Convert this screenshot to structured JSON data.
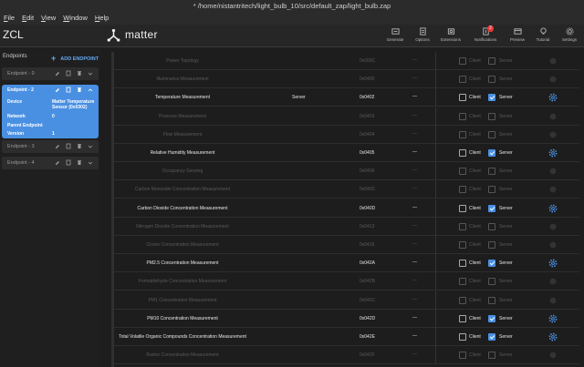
{
  "window": {
    "title": "* /home/nistantritech/light_bulb_10/src/default_zap/light_bulb.zap"
  },
  "menu": [
    {
      "pre": "",
      "u": "F",
      "post": "ile"
    },
    {
      "pre": "",
      "u": "E",
      "post": "dit"
    },
    {
      "pre": "",
      "u": "V",
      "post": "iew"
    },
    {
      "pre": "",
      "u": "W",
      "post": "indow"
    },
    {
      "pre": "",
      "u": "H",
      "post": "elp"
    }
  ],
  "app": {
    "zcl_label": "ZCL",
    "brand": "matter"
  },
  "toolbar": {
    "generate": "Generate",
    "options": "Options",
    "extensions": "Extensions",
    "notifications": "Notifications",
    "notifications_count": "2",
    "preview": "Preview",
    "tutorial": "Tutorial",
    "settings": "Settings"
  },
  "sidebar": {
    "heading": "Endpoints",
    "add_label": "ADD ENDPOINT",
    "endpoint0": "Endpoint - 0",
    "endpoint2": {
      "title": "Endpoint - 2",
      "device_key": "Device",
      "device_val_1": "Matter Temperature",
      "device_val_2": "Sensor (0x0302)",
      "network_key": "Network",
      "network_val": "0",
      "parent_key": "Parent Endpoint",
      "version_key": "Version",
      "version_val": "1"
    },
    "endpoint3": "Endpoint - 3",
    "endpoint4": "Endpoint - 4"
  },
  "clusters": {
    "client_label": "Client",
    "server_label": "Server",
    "rows": [
      {
        "name": "Power Topology",
        "side": "",
        "code": "0x009C",
        "dash": "—",
        "client": false,
        "server": false,
        "enabled": false
      },
      {
        "name": "Illuminance Measurement",
        "side": "",
        "code": "0x0400",
        "dash": "—",
        "client": false,
        "server": false,
        "enabled": false
      },
      {
        "name": "Temperature Measurement",
        "side": "Server",
        "code": "0x0402",
        "dash": "—",
        "client": false,
        "server": true,
        "enabled": true
      },
      {
        "name": "Pressure Measurement",
        "side": "",
        "code": "0x0403",
        "dash": "—",
        "client": false,
        "server": false,
        "enabled": false
      },
      {
        "name": "Flow Measurement",
        "side": "",
        "code": "0x0404",
        "dash": "—",
        "client": false,
        "server": false,
        "enabled": false
      },
      {
        "name": "Relative Humidity Measurement",
        "side": "",
        "code": "0x0405",
        "dash": "—",
        "client": false,
        "server": true,
        "enabled": true
      },
      {
        "name": "Occupancy Sensing",
        "side": "",
        "code": "0x0406",
        "dash": "—",
        "client": false,
        "server": false,
        "enabled": false
      },
      {
        "name": "Carbon Monoxide Concentration Measurement",
        "side": "",
        "code": "0x040C",
        "dash": "—",
        "client": false,
        "server": false,
        "enabled": false
      },
      {
        "name": "Carbon Dioxide Concentration Measurement",
        "side": "",
        "code": "0x040D",
        "dash": "—",
        "client": false,
        "server": true,
        "enabled": true
      },
      {
        "name": "Nitrogen Dioxide Concentration Measurement",
        "side": "",
        "code": "0x0413",
        "dash": "—",
        "client": false,
        "server": false,
        "enabled": false
      },
      {
        "name": "Ozone Concentration Measurement",
        "side": "",
        "code": "0x0415",
        "dash": "—",
        "client": false,
        "server": false,
        "enabled": false
      },
      {
        "name": "PM2.5 Concentration Measurement",
        "side": "",
        "code": "0x042A",
        "dash": "—",
        "client": false,
        "server": true,
        "enabled": true
      },
      {
        "name": "Formaldehyde Concentration Measurement",
        "side": "",
        "code": "0x042B",
        "dash": "—",
        "client": false,
        "server": false,
        "enabled": false
      },
      {
        "name": "PM1 Concentration Measurement",
        "side": "",
        "code": "0x042C",
        "dash": "—",
        "client": false,
        "server": false,
        "enabled": false
      },
      {
        "name": "PM10 Concentration Measurement",
        "side": "",
        "code": "0x042D",
        "dash": "—",
        "client": false,
        "server": true,
        "enabled": true
      },
      {
        "name": "Total Volatile Organic Compounds Concentration Measurement",
        "side": "",
        "code": "0x042E",
        "dash": "—",
        "client": false,
        "server": true,
        "enabled": true
      },
      {
        "name": "Radon Concentration Measurement",
        "side": "",
        "code": "0x042F",
        "dash": "—",
        "client": false,
        "server": false,
        "enabled": false
      }
    ]
  },
  "colors": {
    "accent": "#4a90e2",
    "badge": "#e53935",
    "link": "#64a8f0"
  }
}
